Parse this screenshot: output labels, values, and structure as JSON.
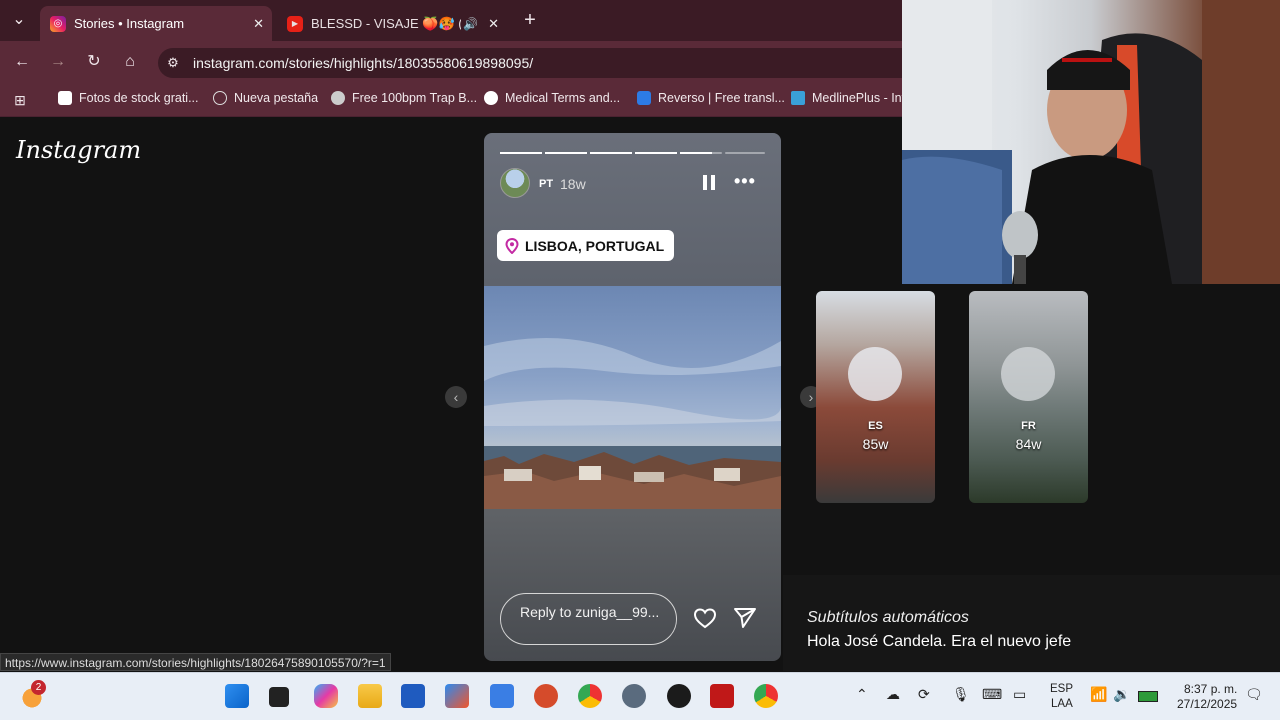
{
  "browser": {
    "tabs": [
      {
        "title": "Stories • Instagram",
        "active": true
      },
      {
        "title": "BLESSD - VISAJE 🍑🥵 (VI"
      }
    ],
    "url": "instagram.com/stories/highlights/18035580619898095/",
    "bookmarks": [
      "Fotos de stock grati...",
      "Nueva pestaña",
      "Free 100bpm Trap B...",
      "Medical Terms and...",
      "Reverso | Free transl...",
      "MedlinePlus - Inf"
    ],
    "status_url": "https://www.instagram.com/stories/highlights/18026475890105570/?r=1"
  },
  "instagram": {
    "logo": "Instagram",
    "story": {
      "user": "PT",
      "time": "18w",
      "location": "LISBOA, PORTUGAL",
      "reply_placeholder": "Reply to zuniga__99...",
      "progress": [
        1,
        1,
        1,
        1,
        0.75,
        0
      ]
    },
    "next_highlights": [
      {
        "label": "ES",
        "time": "85w"
      },
      {
        "label": "FR",
        "time": "84w"
      }
    ]
  },
  "captions": {
    "title": "Subtítulos automáticos",
    "text": "Hola José Candela. Era el nuevo jefe"
  },
  "taskbar": {
    "notification_badge": "2",
    "language": "ESP",
    "layout": "LAA",
    "time": "8:37 p. m.",
    "date": "27/12/2025"
  }
}
